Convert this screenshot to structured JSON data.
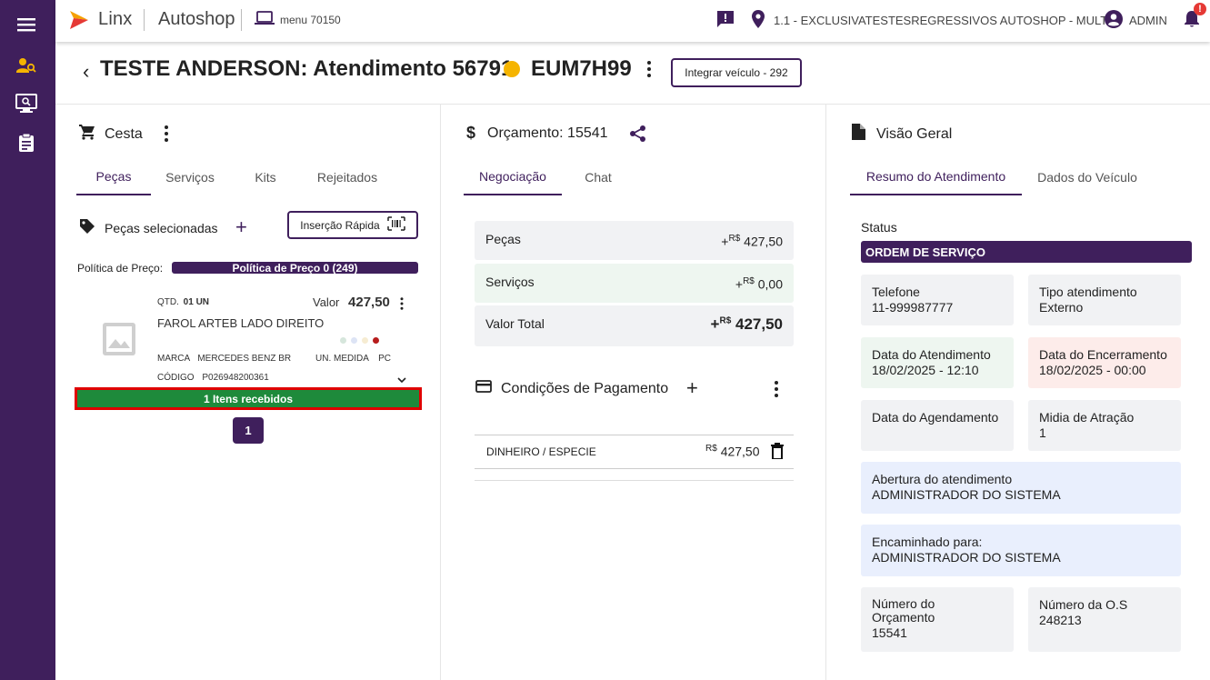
{
  "colors": {
    "primary": "#3f1f5c",
    "status_dot": "#f5b400",
    "received": "#1e8a3b",
    "highlight": "#e00000",
    "notification": "#e53935"
  },
  "sidebar": {
    "items": [
      {
        "icon": "hamburger-icon"
      },
      {
        "icon": "user-search-icon"
      },
      {
        "icon": "monitor-search-icon"
      },
      {
        "icon": "clipboard-icon"
      }
    ]
  },
  "topbar": {
    "brand": "Linx",
    "product": "Autoshop",
    "menu_label": "menu 70150",
    "store": "1.1 - EXCLUSIVATESTESREGRESSIVOS AUTOSHOP - MULT",
    "user": "ADMIN",
    "notification_badge": "!"
  },
  "header": {
    "back": "‹",
    "title": "TESTE ANDERSON: Atendimento 56791",
    "plate": "EUM7H99",
    "integrate_button": "Integrar veículo - 292"
  },
  "cesta": {
    "title": "Cesta",
    "tabs": [
      "Peças",
      "Serviços",
      "Kits",
      "Rejeitados"
    ],
    "selected_label": "Peças selecionadas",
    "quick_insert": "Inserção Rápida",
    "price_policy_label": "Política de Preço:",
    "price_policy_value": "Política de Preço 0 (249)",
    "item": {
      "qty_label": "QTD.",
      "qty_value": "01 UN",
      "value_label": "Valor",
      "value": "427,50",
      "name": "FAROL ARTEB LADO DIREITO",
      "brand_label": "MARCA",
      "brand_value": "MERCEDES BENZ BR",
      "unit_label": "UN. MEDIDA",
      "unit_value": "PC",
      "code_label": "CÓDIGO",
      "code_value": "P026948200361",
      "received": "1 Itens recebidos"
    },
    "page": "1"
  },
  "orcamento": {
    "title": "Orçamento: 15541",
    "tabs": [
      "Negociação",
      "Chat"
    ],
    "rows": [
      {
        "label": "Peças",
        "sign": "+",
        "currency": "R$",
        "value": "427,50"
      },
      {
        "label": "Serviços",
        "sign": "+",
        "currency": "R$",
        "value": "0,00"
      },
      {
        "label": "Valor Total",
        "sign": "+",
        "currency": "R$",
        "value": "427,50"
      }
    ],
    "payment_title": "Condições de Pagamento",
    "payment": {
      "method": "DINHEIRO / ESPECIE",
      "currency": "R$",
      "value": "427,50"
    }
  },
  "visao": {
    "title": "Visão Geral",
    "tabs": [
      "Resumo do Atendimento",
      "Dados do Veículo"
    ],
    "status_label": "Status",
    "status_value": "ORDEM DE SERVIÇO",
    "cards": {
      "telefone_label": "Telefone",
      "telefone_value": "11-999987777",
      "tipo_label": "Tipo atendimento",
      "tipo_value": "Externo",
      "data_atend_label": "Data do Atendimento",
      "data_atend_value": "18/02/2025 - 12:10",
      "data_enc_label": "Data do Encerramento",
      "data_enc_value": "18/02/2025 - 00:00",
      "data_agend_label": "Data do Agendamento",
      "midia_label": "Midia de Atração",
      "midia_value": "1",
      "abertura_label": "Abertura do atendimento",
      "abertura_value": "ADMINISTRADOR DO SISTEMA",
      "encaminhado_label": "Encaminhado para:",
      "encaminhado_value": "ADMINISTRADOR DO SISTEMA",
      "num_orc_label_1": "Número do",
      "num_orc_label_2": "Orçamento",
      "num_orc_value": "15541",
      "num_os_label": "Número da O.S",
      "num_os_value": "248213"
    }
  }
}
